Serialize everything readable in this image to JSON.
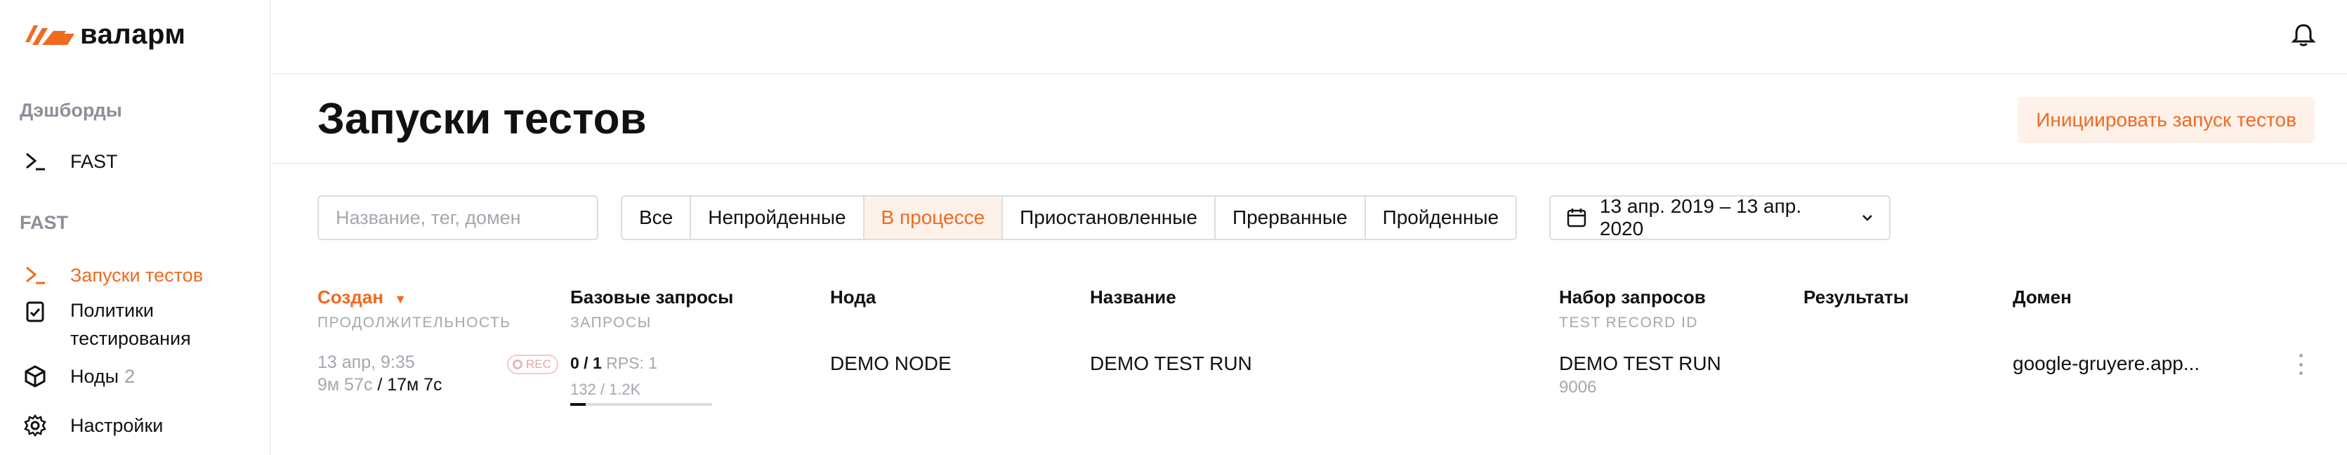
{
  "brand": {
    "name": "валарм"
  },
  "sidebar": {
    "section_dashboards": "Дэшборды",
    "dashboards_item": "FAST",
    "section_fast": "FAST",
    "items": [
      {
        "label": "Запуски тестов",
        "icon": "terminal-icon",
        "active": true
      },
      {
        "label": "Политики тестирования",
        "icon": "checklist-icon"
      },
      {
        "label": "Ноды",
        "count": "2",
        "icon": "hexagon-nodes-icon"
      },
      {
        "label": "Настройки",
        "icon": "gear-icon"
      }
    ]
  },
  "header": {
    "title": "Запуски тестов",
    "init_button": "Инициировать запуск тестов"
  },
  "filters": {
    "search_placeholder": "Название, тег, домен",
    "segments": [
      "Все",
      "Непройденные",
      "В процессе",
      "Приостановленные",
      "Прерванные",
      "Пройденные"
    ],
    "active_segment": "В процессе",
    "date_range": "13 апр. 2019 – 13 апр. 2020"
  },
  "table": {
    "columns": [
      {
        "title": "Создан",
        "sub": "ПРОДОЛЖИТЕЛЬНОСТЬ",
        "sorted": "desc"
      },
      {
        "title": "Базовые запросы",
        "sub": "ЗАПРОСЫ"
      },
      {
        "title": "Нода",
        "sub": ""
      },
      {
        "title": "Название",
        "sub": ""
      },
      {
        "title": "Набор запросов",
        "sub": "TEST RECORD ID"
      },
      {
        "title": "Результаты",
        "sub": ""
      },
      {
        "title": "Домен",
        "sub": ""
      }
    ],
    "rows": [
      {
        "created": "13 апр, 9:35",
        "duration_elapsed": "9м 57с",
        "duration_total": "/ 17м 7с",
        "rec_badge": "REC",
        "base_requests": "0 / 1",
        "rps": "RPS: 1",
        "requests": "132 / 1.2K",
        "requests_progress": 0.11,
        "node": "DEMO NODE",
        "name": "DEMO TEST RUN",
        "record_set": "DEMO TEST RUN",
        "record_id": "9006",
        "results": "",
        "domain": "google-gruyere.app..."
      }
    ]
  },
  "colors": {
    "accent": "#f06a20",
    "accent_bg": "#fdf1ea",
    "muted": "#a4a8ae"
  }
}
